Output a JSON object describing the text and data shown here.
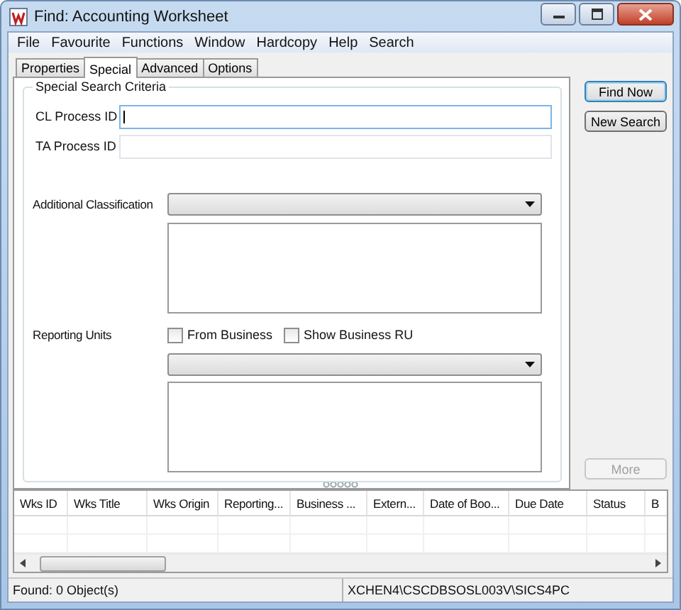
{
  "window": {
    "title": "Find: Accounting Worksheet"
  },
  "menu": [
    "File",
    "Favourite",
    "Functions",
    "Window",
    "Hardcopy",
    "Help",
    "Search"
  ],
  "tabs": [
    {
      "label": "Properties",
      "selected": false
    },
    {
      "label": "Special",
      "selected": true
    },
    {
      "label": "Advanced",
      "selected": false
    },
    {
      "label": "Options",
      "selected": false
    }
  ],
  "criteria": {
    "title": "Special Search Criteria",
    "fields": [
      {
        "label": "CL Process ID",
        "focused": true
      },
      {
        "label": "TA Process ID",
        "focused": false
      }
    ],
    "classification": {
      "label": "Additional Classification"
    },
    "reporting_units": {
      "label": "Reporting Units",
      "checkboxes": [
        {
          "label": "From Business",
          "checked": false
        },
        {
          "label": "Show Business RU",
          "checked": false
        }
      ]
    }
  },
  "buttons": [
    {
      "label": "Find Now",
      "disabled": false,
      "default": true
    },
    {
      "label": "New Search",
      "disabled": false,
      "default": false
    }
  ],
  "more_button": {
    "label": "More",
    "disabled": true
  },
  "table": {
    "columns": [
      "Wks ID",
      "Wks Title",
      "Wks Origin",
      "Reporting...",
      "Business ...",
      "Extern...",
      "Date of Boo...",
      "Due Date",
      "Status",
      "B"
    ]
  },
  "status_bar": [
    "Found: 0 Object(s)",
    "XCHEN4\\CSCDBSOSL003V\\SICS4PC"
  ]
}
